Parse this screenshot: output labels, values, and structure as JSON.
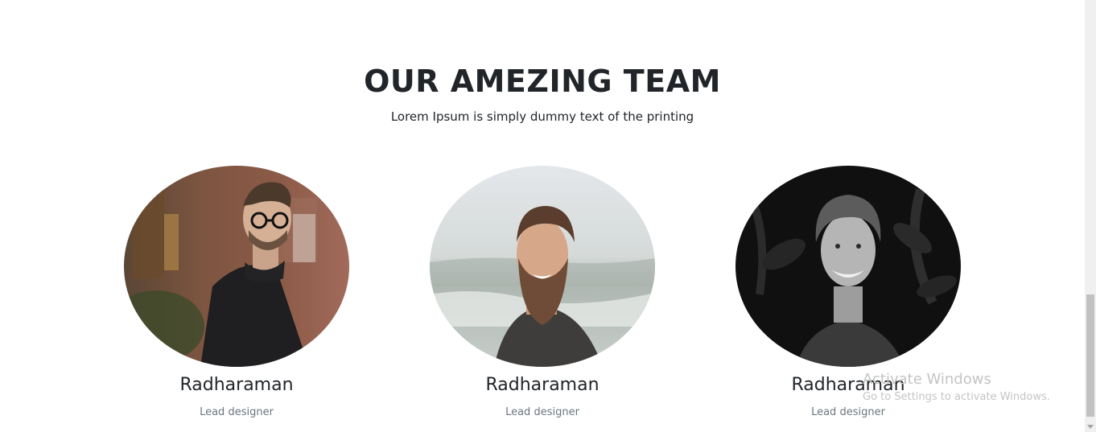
{
  "team_section": {
    "title": "OUR AMEZING TEAM",
    "subtitle": "Lorem Ipsum is simply dummy text of the printing"
  },
  "members": [
    {
      "name": "Radharaman",
      "role": "Lead designer",
      "photo": "man-glasses-turtleneck-photo"
    },
    {
      "name": "Radharaman",
      "role": "Lead designer",
      "photo": "bearded-man-beach-photo"
    },
    {
      "name": "Radharaman",
      "role": "Lead designer",
      "photo": "smiling-man-bw-photo"
    }
  ],
  "os_overlay": {
    "title": "Activate Windows",
    "subtitle": "Go to Settings to activate Windows."
  },
  "colors": {
    "heading": "#212529",
    "muted": "#6c757d",
    "watermark": "#c4c4c4",
    "scrollbar_thumb": "#c1c1c1"
  }
}
